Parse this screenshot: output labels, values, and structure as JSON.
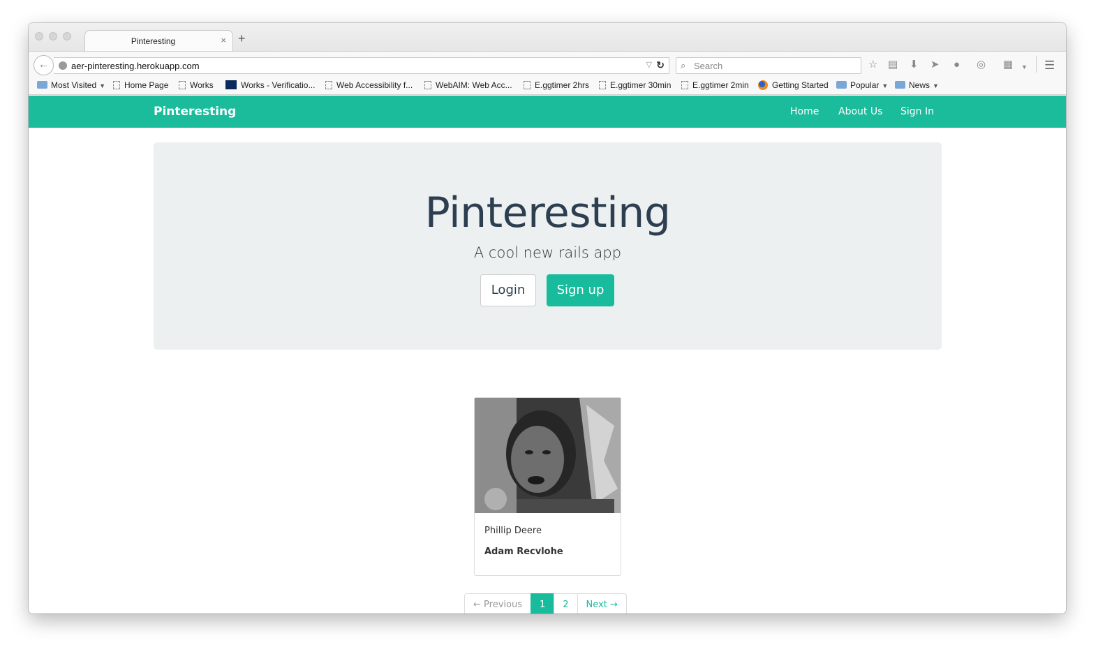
{
  "browser": {
    "tab_title": "Pinteresting",
    "tab_close": "×",
    "new_tab": "+",
    "url": "aer-pinteresting.herokuapp.com",
    "search_placeholder": "Search",
    "back_arrow": "←",
    "reload": "C"
  },
  "bookmarks": [
    {
      "label": "Most Visited",
      "icon": "folder-icon",
      "dropdown": true
    },
    {
      "label": "Home Page",
      "icon": "page-icon"
    },
    {
      "label": "Works",
      "icon": "page-icon"
    },
    {
      "label": "Works - Verificatio...",
      "icon": "shield-icon"
    },
    {
      "label": "Web Accessibility f...",
      "icon": "page-icon"
    },
    {
      "label": "WebAIM: Web Acc...",
      "icon": "page-icon"
    },
    {
      "label": "E.ggtimer 2hrs",
      "icon": "page-icon"
    },
    {
      "label": "E.ggtimer 30min",
      "icon": "page-icon"
    },
    {
      "label": "E.ggtimer 2min",
      "icon": "page-icon"
    },
    {
      "label": "Getting Started",
      "icon": "firefox-icon"
    },
    {
      "label": "Popular",
      "icon": "folder-icon",
      "dropdown": true
    },
    {
      "label": "News",
      "icon": "folder-icon",
      "dropdown": true
    }
  ],
  "navbar": {
    "brand": "Pinteresting",
    "links": [
      "Home",
      "About Us",
      "Sign In"
    ],
    "color": "#1abc9c"
  },
  "jumbotron": {
    "title": "Pinteresting",
    "subtitle": "A cool new rails app",
    "login_label": "Login",
    "signup_label": "Sign up"
  },
  "pins": [
    {
      "description": "Phillip Deere",
      "user": "Adam Recvlohe"
    }
  ],
  "pagination": {
    "previous": "← Previous",
    "pages": [
      "1",
      "2"
    ],
    "active_page": "1",
    "next": "Next →"
  }
}
